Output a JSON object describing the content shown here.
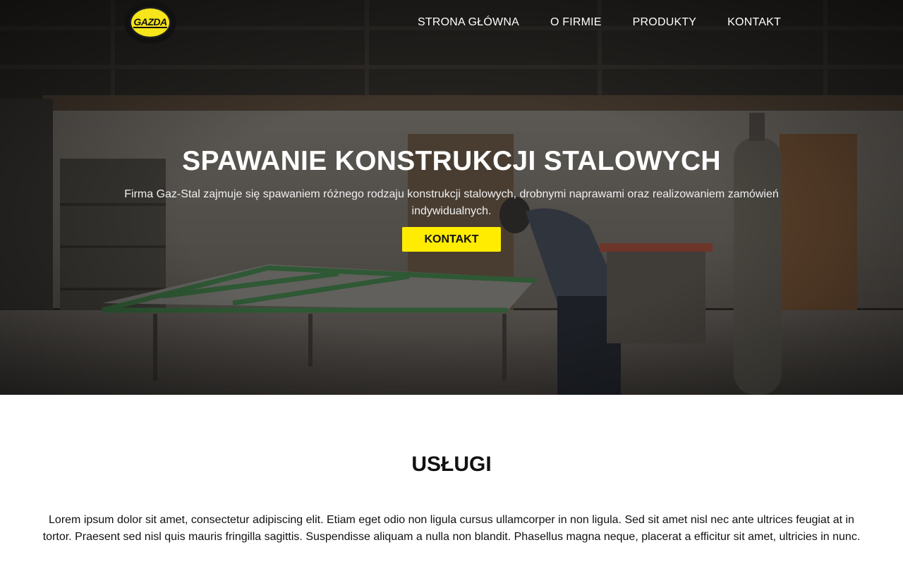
{
  "header": {
    "logo_text": "GAZDA",
    "nav": [
      {
        "label": "STRONA GŁÓWNA"
      },
      {
        "label": "O FIRMIE"
      },
      {
        "label": "PRODUKTY"
      },
      {
        "label": "KONTAKT"
      }
    ]
  },
  "hero": {
    "title": "SPAWANIE KONSTRUKCJI STALOWYCH",
    "text": "Firma Gaz-Stal zajmuje się spawaniem różnego rodzaju konstrukcji stalowych, drobnymi naprawami oraz realizowaniem zamówień indywidualnych.",
    "button_label": "KONTAKT"
  },
  "services": {
    "title": "USŁUGI",
    "text": "Lorem ipsum dolor sit amet, consectetur adipiscing elit. Etiam eget odio non ligula cursus ullamcorper in non ligula. Sed sit amet nisl nec ante ultrices feugiat at in tortor. Praesent sed nisl quis mauris fringilla sagittis. Suspendisse aliquam a nulla non blandit. Phasellus magna neque, placerat a efficitur sit amet, ultricies in nunc."
  },
  "colors": {
    "accent": "#ffec00",
    "logo_yellow": "#f6e51a",
    "hero_overlay": "#1c1a18"
  }
}
